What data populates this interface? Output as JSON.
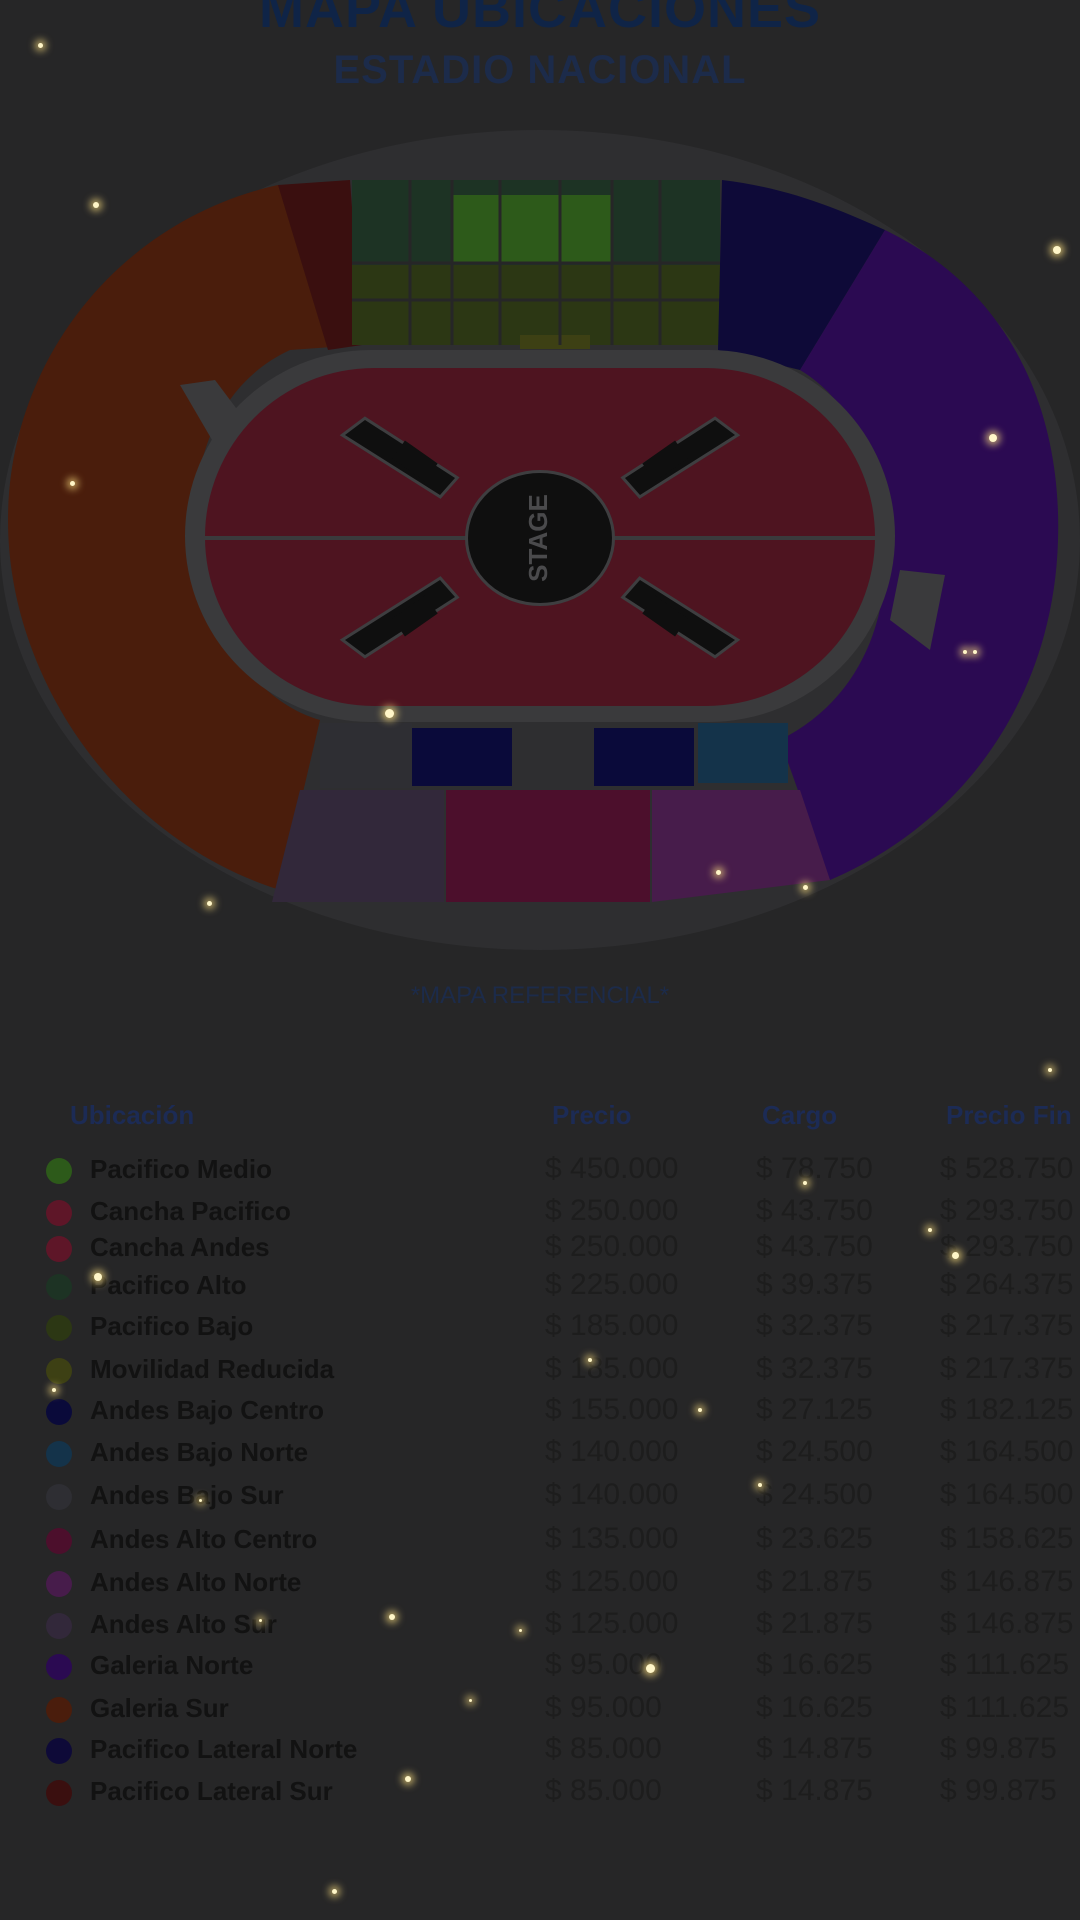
{
  "header": {
    "title": "MAPA UBICACIONES",
    "subtitle": "ESTADIO NACIONAL"
  },
  "map": {
    "stage_label": "STAGE",
    "note": "*MAPA REFERENCIAL*"
  },
  "table": {
    "columns": [
      "Ubicación",
      "Precio",
      "Cargo",
      "Precio Fin"
    ],
    "rows": [
      {
        "name": "Pacifico Medio",
        "color": "#2d5a1a",
        "precio": "$ 450.000",
        "cargo": "$ 78.750",
        "final": "$ 528.750"
      },
      {
        "name": "Cancha Pacifico",
        "color": "#5e1628",
        "precio": "$ 250.000",
        "cargo": "$ 43.750",
        "final": "$ 293.750"
      },
      {
        "name": "Cancha Andes",
        "color": "#5e1628",
        "precio": "$ 250.000",
        "cargo": "$ 43.750",
        "final": "$ 293.750"
      },
      {
        "name": "Pacifico Alto",
        "color": "#1d3324",
        "precio": "$ 225.000",
        "cargo": "$ 39.375",
        "final": "$ 264.375"
      },
      {
        "name": "Pacifico Bajo",
        "color": "#2c3714",
        "precio": "$ 185.000",
        "cargo": "$ 32.375",
        "final": "$ 217.375"
      },
      {
        "name": "Movilidad Reducida",
        "color": "#3d4014",
        "precio": "$ 185.000",
        "cargo": "$ 32.375",
        "final": "$ 217.375"
      },
      {
        "name": "Andes Bajo Centro",
        "color": "#0a0a3a",
        "precio": "$ 155.000",
        "cargo": "$ 27.125",
        "final": "$ 182.125"
      },
      {
        "name": "Andes Bajo Norte",
        "color": "#14334a",
        "precio": "$ 140.000",
        "cargo": "$ 24.500",
        "final": "$ 164.500"
      },
      {
        "name": "Andes Bajo Sur",
        "color": "#2e2e33",
        "precio": "$ 140.000",
        "cargo": "$ 24.500",
        "final": "$ 164.500"
      },
      {
        "name": "Andes Alto Centro",
        "color": "#4c0f2c",
        "precio": "$ 135.000",
        "cargo": "$ 23.625",
        "final": "$ 158.625"
      },
      {
        "name": "Andes Alto Norte",
        "color": "#471c4b",
        "precio": "$ 125.000",
        "cargo": "$ 21.875",
        "final": "$ 146.875"
      },
      {
        "name": "Andes Alto Sur",
        "color": "#32283a",
        "precio": "$ 125.000",
        "cargo": "$ 21.875",
        "final": "$ 146.875"
      },
      {
        "name": "Galeria Norte",
        "color": "#2b0a52",
        "precio": "$ 95.000",
        "cargo": "$ 16.625",
        "final": "$ 111.625"
      },
      {
        "name": "Galeria Sur",
        "color": "#4a1d0c",
        "precio": "$ 95.000",
        "cargo": "$ 16.625",
        "final": "$ 111.625"
      },
      {
        "name": "Pacifico Lateral Norte",
        "color": "#0e0a38",
        "precio": "$ 85.000",
        "cargo": "$ 14.875",
        "final": "$ 99.875"
      },
      {
        "name": "Pacifico Lateral Sur",
        "color": "#3a0f0f",
        "precio": "$ 85.000",
        "cargo": "$ 14.875",
        "final": "$ 99.875"
      }
    ]
  },
  "colors": {
    "background": "#262627",
    "title": "#0f2447",
    "cancha": "#4e1420",
    "galeria_sur": "#4a1d0c",
    "galeria_norte": "#2b0a52",
    "stage": "#0f0f0f"
  }
}
